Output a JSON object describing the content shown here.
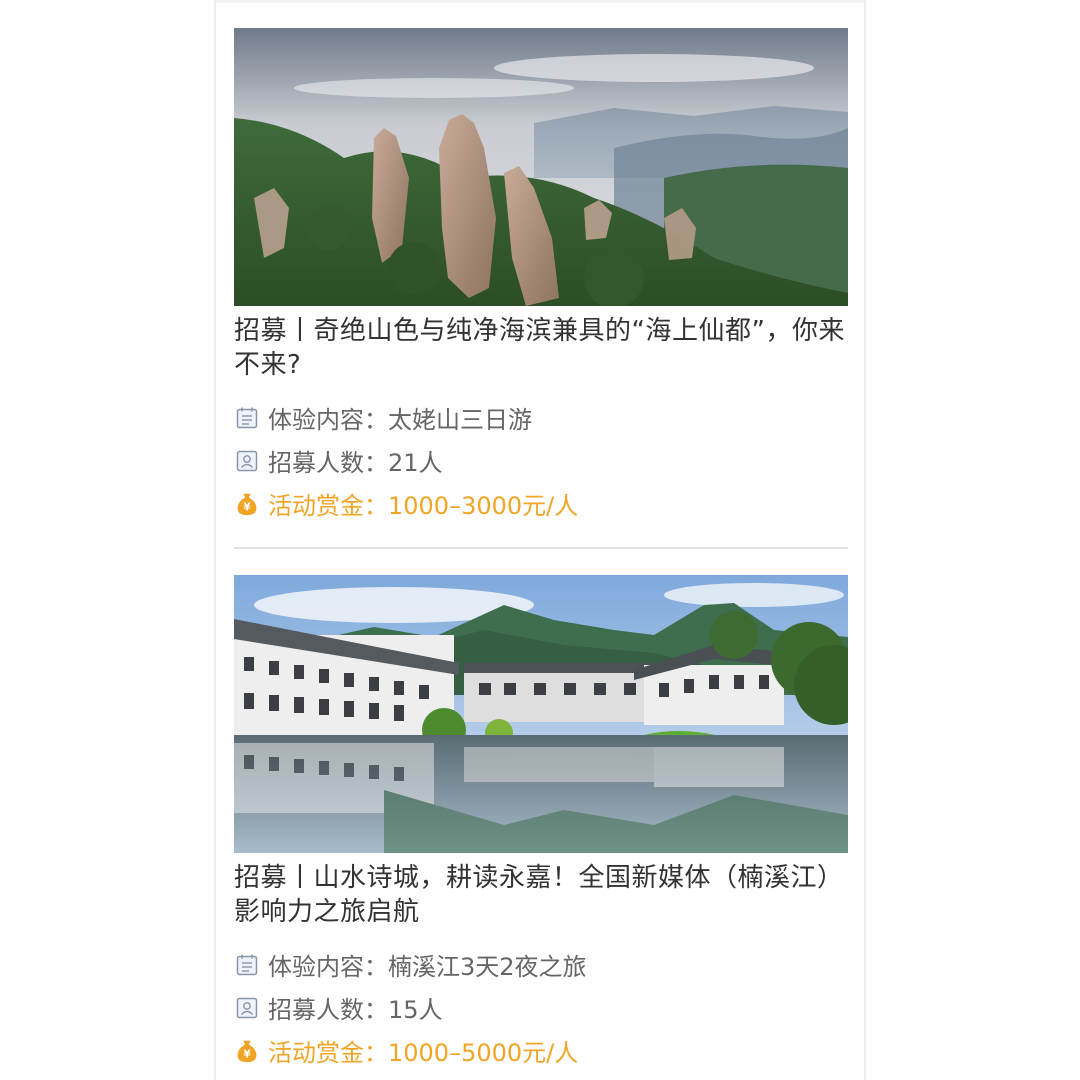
{
  "colors": {
    "accent_reward": "#f0a526",
    "text_main": "#333333",
    "text_meta": "#666666"
  },
  "cards": [
    {
      "image_name": "mountain-landscape-image",
      "title": "招募丨奇绝山色与纯净海滨兼具的“海上仙都”，你来不来?",
      "content_label": "体验内容：",
      "content_value": "太姥山三日游",
      "people_label": "招募人数：",
      "people_value": "21人",
      "reward_label": "活动赏金：",
      "reward_value": "1000–3000元/人"
    },
    {
      "image_name": "water-town-image",
      "title": "招募丨山水诗城，耕读永嘉！全国新媒体（楠溪江）影响力之旅启航",
      "content_label": "体验内容：",
      "content_value": "楠溪江3天2夜之旅",
      "people_label": "招募人数：",
      "people_value": "15人",
      "reward_label": "活动赏金：",
      "reward_value": "1000–5000元/人"
    }
  ],
  "icons": {
    "content": "calendar-icon",
    "people": "person-icon",
    "reward": "money-bag-icon"
  }
}
